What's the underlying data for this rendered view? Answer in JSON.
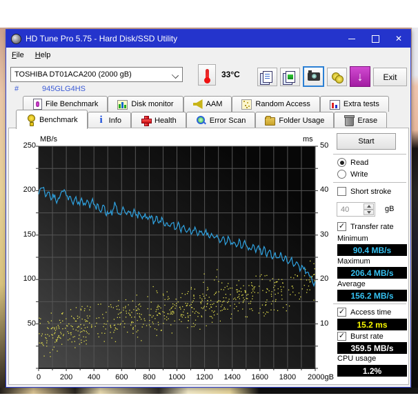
{
  "window": {
    "title": "HD Tune Pro 5.75 - Hard Disk/SSD Utility"
  },
  "menu": {
    "items": [
      {
        "label": "File"
      },
      {
        "label": "Help"
      }
    ]
  },
  "toolbar": {
    "drive": "TOSHIBA DT01ACA200 (2000 gB)",
    "temperature": "33°C",
    "exit_label": "Exit",
    "icons": [
      "thermometer-icon",
      "copy-text-icon",
      "copy-image-icon",
      "camera-icon",
      "donate-coins-icon",
      "download-update-icon"
    ]
  },
  "serial": {
    "hash": "#",
    "value": "945GLG4HS"
  },
  "tabs": {
    "row1": [
      {
        "label": "File Benchmark",
        "icon": "file-benchmark-icon",
        "cls": "ti-filedoc"
      },
      {
        "label": "Disk monitor",
        "icon": "disk-monitor-icon",
        "cls": "ti-bars"
      },
      {
        "label": "AAM",
        "icon": "aam-speaker-icon",
        "cls": "ti-speaker"
      },
      {
        "label": "Random Access",
        "icon": "random-access-icon",
        "cls": "ti-dots"
      },
      {
        "label": "Extra tests",
        "icon": "extra-tests-icon",
        "cls": "ti-grid"
      }
    ],
    "row2": [
      {
        "label": "Benchmark",
        "icon": "benchmark-lamp-icon",
        "cls": "ti-lamp",
        "active": true
      },
      {
        "label": "Info",
        "icon": "info-icon",
        "cls": "ti-info",
        "glyph": "i"
      },
      {
        "label": "Health",
        "icon": "health-cross-icon",
        "cls": "ti-cross"
      },
      {
        "label": "Error Scan",
        "icon": "error-scan-magnifier-icon",
        "cls": "ti-mag"
      },
      {
        "label": "Folder Usage",
        "icon": "folder-usage-icon",
        "cls": "ti-folder"
      },
      {
        "label": "Erase",
        "icon": "erase-trash-icon",
        "cls": "ti-trash"
      }
    ],
    "active": "Benchmark"
  },
  "controls": {
    "start_label": "Start",
    "read_label": "Read",
    "write_label": "Write",
    "read_selected": true,
    "short_stroke_label": "Short stroke",
    "short_stroke_checked": false,
    "gb_value": "40",
    "gb_unit": "gB",
    "transfer_rate_label": "Transfer rate",
    "transfer_rate_checked": true,
    "check_glyph": "✓",
    "minimum": {
      "label": "Minimum",
      "value": "90.4 MB/s"
    },
    "maximum": {
      "label": "Maximum",
      "value": "206.4 MB/s"
    },
    "average": {
      "label": "Average",
      "value": "156.2 MB/s"
    },
    "access_time": {
      "label": "Access time",
      "value": "15.2 ms",
      "checked": true
    },
    "burst_rate": {
      "label": "Burst rate",
      "value": "359.5 MB/s",
      "checked": true
    },
    "cpu_usage": {
      "label": "CPU usage",
      "value": "1.2%"
    }
  },
  "colors": {
    "titlebar": "#2434cc",
    "transfer_line": "#2fa2e0",
    "access_dots": "#e6e24e",
    "value_cyan": "#35c1f1",
    "value_yellow": "#f8f800",
    "grid": "#565656"
  },
  "chart_data": {
    "type": "line+scatter",
    "title": "HD Tune read benchmark: transfer rate (MB/s, blue line, left axis) and access time scatter (ms, yellow dots, right axis) across disk position 0-2000 gB",
    "x_axis": {
      "unit": "gB",
      "min": 0,
      "max": 2000,
      "tick_labels": [
        "0",
        "200",
        "400",
        "600",
        "800",
        "1000",
        "1200",
        "1400",
        "1600",
        "1800",
        "2000gB"
      ],
      "grid_step": 100
    },
    "left_axis": {
      "label": "MB/s",
      "min": 0,
      "max": 250,
      "tick_labels": [
        "250",
        "200",
        "150",
        "100",
        "50"
      ],
      "grid_step": 25
    },
    "right_axis": {
      "label": "ms",
      "min": 0,
      "max": 50,
      "tick_labels": [
        "50",
        "40",
        "30",
        "20",
        "10"
      ]
    },
    "transfer_rate_anchors": [
      [
        0,
        196
      ],
      [
        15,
        202
      ],
      [
        30,
        206
      ],
      [
        50,
        195
      ],
      [
        70,
        199
      ],
      [
        90,
        192
      ],
      [
        110,
        195
      ],
      [
        130,
        188
      ],
      [
        150,
        193
      ],
      [
        170,
        199
      ],
      [
        185,
        203
      ],
      [
        200,
        197
      ],
      [
        215,
        189
      ],
      [
        230,
        193
      ],
      [
        250,
        187
      ],
      [
        270,
        191
      ],
      [
        290,
        185
      ],
      [
        310,
        189
      ],
      [
        330,
        184
      ],
      [
        350,
        188
      ],
      [
        370,
        182
      ],
      [
        390,
        189
      ],
      [
        410,
        180
      ],
      [
        430,
        184
      ],
      [
        450,
        178
      ],
      [
        470,
        183
      ],
      [
        490,
        171
      ],
      [
        510,
        178
      ],
      [
        530,
        173
      ],
      [
        550,
        185
      ],
      [
        570,
        177
      ],
      [
        590,
        172
      ],
      [
        610,
        180
      ],
      [
        630,
        174
      ],
      [
        650,
        178
      ],
      [
        670,
        172
      ],
      [
        690,
        176
      ],
      [
        710,
        170
      ],
      [
        730,
        175
      ],
      [
        750,
        168
      ],
      [
        770,
        173
      ],
      [
        790,
        167
      ],
      [
        810,
        172
      ],
      [
        830,
        165
      ],
      [
        850,
        170
      ],
      [
        870,
        163
      ],
      [
        890,
        168
      ],
      [
        910,
        161
      ],
      [
        930,
        166
      ],
      [
        950,
        159
      ],
      [
        970,
        164
      ],
      [
        990,
        157
      ],
      [
        1010,
        162
      ],
      [
        1030,
        156
      ],
      [
        1050,
        160
      ],
      [
        1070,
        154
      ],
      [
        1090,
        158
      ],
      [
        1110,
        152
      ],
      [
        1130,
        157
      ],
      [
        1150,
        150
      ],
      [
        1170,
        155
      ],
      [
        1190,
        148
      ],
      [
        1210,
        154
      ],
      [
        1230,
        147
      ],
      [
        1250,
        152
      ],
      [
        1270,
        145
      ],
      [
        1290,
        150
      ],
      [
        1310,
        143
      ],
      [
        1330,
        148
      ],
      [
        1350,
        141
      ],
      [
        1370,
        146
      ],
      [
        1390,
        140
      ],
      [
        1410,
        144
      ],
      [
        1430,
        138
      ],
      [
        1450,
        143
      ],
      [
        1470,
        136
      ],
      [
        1490,
        141
      ],
      [
        1510,
        138
      ],
      [
        1530,
        133
      ],
      [
        1550,
        138
      ],
      [
        1570,
        131
      ],
      [
        1590,
        136
      ],
      [
        1610,
        130
      ],
      [
        1630,
        134
      ],
      [
        1650,
        128
      ],
      [
        1670,
        132
      ],
      [
        1690,
        126
      ],
      [
        1710,
        130
      ],
      [
        1730,
        124
      ],
      [
        1750,
        128
      ],
      [
        1770,
        121
      ],
      [
        1790,
        125
      ],
      [
        1810,
        119
      ],
      [
        1830,
        122
      ],
      [
        1850,
        116
      ],
      [
        1870,
        119
      ],
      [
        1890,
        112
      ],
      [
        1910,
        115
      ],
      [
        1930,
        108
      ],
      [
        1950,
        110
      ],
      [
        1965,
        103
      ],
      [
        1980,
        98
      ],
      [
        1990,
        94
      ],
      [
        2000,
        98
      ]
    ],
    "line_jitter_mbs": 3.2,
    "access_time_scatter": {
      "count": 640,
      "ms_start": 7.5,
      "ms_end": 19.0,
      "spread": 5.5,
      "outlier_chance": 0.04,
      "seed": 7
    },
    "summary": {
      "minimum_mbs": 90.4,
      "maximum_mbs": 206.4,
      "average_mbs": 156.2,
      "access_time_ms": 15.2,
      "burst_rate_mbs": 359.5,
      "cpu_usage_pct": 1.2
    }
  }
}
